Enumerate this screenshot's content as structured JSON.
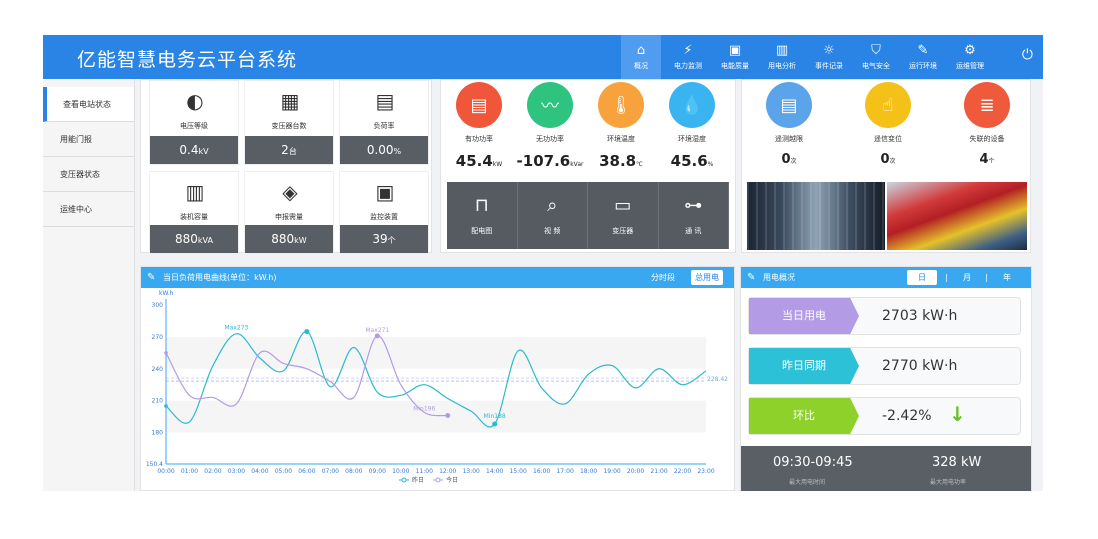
{
  "app": {
    "title": "亿能智慧电务云平台系统"
  },
  "nav": [
    {
      "label": "概况",
      "icon": "home-icon",
      "glyph": "⌂"
    },
    {
      "label": "电力监测",
      "icon": "plug-icon",
      "glyph": "⚡"
    },
    {
      "label": "电能质量",
      "icon": "quality-icon",
      "glyph": "▣"
    },
    {
      "label": "用电分析",
      "icon": "bar-chart-icon",
      "glyph": "▥"
    },
    {
      "label": "事件记录",
      "icon": "alarm-icon",
      "glyph": "☼"
    },
    {
      "label": "电气安全",
      "icon": "shield-icon",
      "glyph": "⛉"
    },
    {
      "label": "运行环境",
      "icon": "tools-icon",
      "glyph": "✎"
    },
    {
      "label": "运维管理",
      "icon": "gear-icon",
      "glyph": "⚙"
    }
  ],
  "power_icon": "⏻",
  "sidebar": [
    {
      "label": "查看电站状态"
    },
    {
      "label": "用能门报"
    },
    {
      "label": "变压器状态"
    },
    {
      "label": "运维中心"
    }
  ],
  "station": [
    {
      "label": "电压等级",
      "value": "0.4",
      "unit": "kV",
      "icon": "gauge-icon",
      "glyph": "◐"
    },
    {
      "label": "变压器台数",
      "value": "2",
      "unit": "台",
      "icon": "transformer-icon",
      "glyph": "▦"
    },
    {
      "label": "负荷率",
      "value": "0.00",
      "unit": "%",
      "icon": "load-rate-icon",
      "glyph": "▤"
    },
    {
      "label": "装机容量",
      "value": "880",
      "unit": "kVA",
      "icon": "cabinet-icon",
      "glyph": "▥"
    },
    {
      "label": "申报需量",
      "value": "880",
      "unit": "kW",
      "icon": "layers-icon",
      "glyph": "◈"
    },
    {
      "label": "监控装置",
      "value": "39",
      "unit": "个",
      "icon": "monitor-icon",
      "glyph": "▣"
    }
  ],
  "metrics": [
    {
      "label": "有功功率",
      "value": "45.4",
      "unit": "kW",
      "color": "#f0573a",
      "icon": "active-power-icon",
      "glyph": "▤"
    },
    {
      "label": "无功功率",
      "value": "-107.6",
      "unit": "kVar",
      "color": "#2ec480",
      "icon": "reactive-power-icon",
      "glyph": "〰"
    },
    {
      "label": "环境温度",
      "value": "38.8",
      "unit": "℃",
      "color": "#f7a23c",
      "icon": "thermometer-icon",
      "glyph": "🌡"
    },
    {
      "label": "环境湿度",
      "value": "45.6",
      "unit": "%",
      "color": "#3ab4f0",
      "icon": "humidity-icon",
      "glyph": "💧"
    }
  ],
  "functions": [
    {
      "label": "配电图",
      "icon": "distribution-icon",
      "glyph": "⊓"
    },
    {
      "label": "视 频",
      "icon": "camera-icon",
      "glyph": "⌕"
    },
    {
      "label": "变压器",
      "icon": "battery-icon",
      "glyph": "▭"
    },
    {
      "label": "通 讯",
      "icon": "network-icon",
      "glyph": "⊶"
    }
  ],
  "alarms": [
    {
      "label": "遥测越限",
      "value": "0",
      "unit": "次",
      "color": "#5ba4ea",
      "icon": "telemetry-icon",
      "glyph": "▤"
    },
    {
      "label": "遥信变位",
      "value": "0",
      "unit": "次",
      "color": "#f3c117",
      "icon": "signal-icon",
      "glyph": "☝"
    },
    {
      "label": "失联的设备",
      "value": "4",
      "unit": "个",
      "color": "#ef5a3c",
      "icon": "server-icon",
      "glyph": "≣"
    }
  ],
  "curve_panel": {
    "title": "当日负荷用电曲线(单位：kW.h)",
    "tabs": [
      "分时段",
      "总用电"
    ],
    "ylabel": "kW.h",
    "legend": [
      "昨日",
      "今日"
    ],
    "annotations": {
      "max_yesterday": "Max273",
      "max_today": "Max271",
      "min_today": "Min196",
      "min_yesterday": "Min188",
      "avg": "228.42"
    }
  },
  "chart_data": {
    "type": "line",
    "ylabel": "kW.h",
    "ylim": [
      150.4,
      300
    ],
    "yticks": [
      "300",
      "270",
      "240",
      "210",
      "180",
      "150.4"
    ],
    "categories": [
      "00:00",
      "01:00",
      "02:00",
      "03:00",
      "04:00",
      "05:00",
      "06:00",
      "07:00",
      "08:00",
      "09:00",
      "10:00",
      "11:00",
      "12:00",
      "13:00",
      "14:00",
      "15:00",
      "16:00",
      "17:00",
      "18:00",
      "19:00",
      "20:00",
      "21:00",
      "22:00",
      "23:00"
    ],
    "series": [
      {
        "name": "昨日",
        "color": "#2bbacd",
        "values": [
          205,
          190,
          243,
          273,
          250,
          238,
          275,
          223,
          260,
          218,
          215,
          225,
          212,
          200,
          188,
          257,
          222,
          207,
          235,
          243,
          222,
          240,
          225,
          238
        ]
      },
      {
        "name": "今日",
        "color": "#b49be6",
        "values": [
          255,
          215,
          213,
          207,
          255,
          245,
          240,
          228,
          213,
          271,
          225,
          199,
          196,
          null,
          null,
          null,
          null,
          null,
          null,
          null,
          null,
          null,
          null,
          null
        ]
      }
    ],
    "average": 228.42,
    "legend_position": "bottom"
  },
  "usage": {
    "title": "用电概况",
    "tabs": [
      "日",
      "月",
      "年"
    ],
    "cards": [
      {
        "label": "当日用电",
        "value": "2703 kW·h",
        "color": "#b39be5"
      },
      {
        "label": "昨日同期",
        "value": "2770 kW·h",
        "color": "#2cc1d6"
      },
      {
        "label": "环比",
        "value": "-2.42%",
        "color": "#8dd12a",
        "arrow": "↓",
        "arrow_color": "#6abf2b"
      }
    ],
    "peak_time": "09:30-09:45",
    "peak_time_label": "最大用电时间",
    "peak_value": "328 kW",
    "peak_value_label": "最大用电功率"
  }
}
